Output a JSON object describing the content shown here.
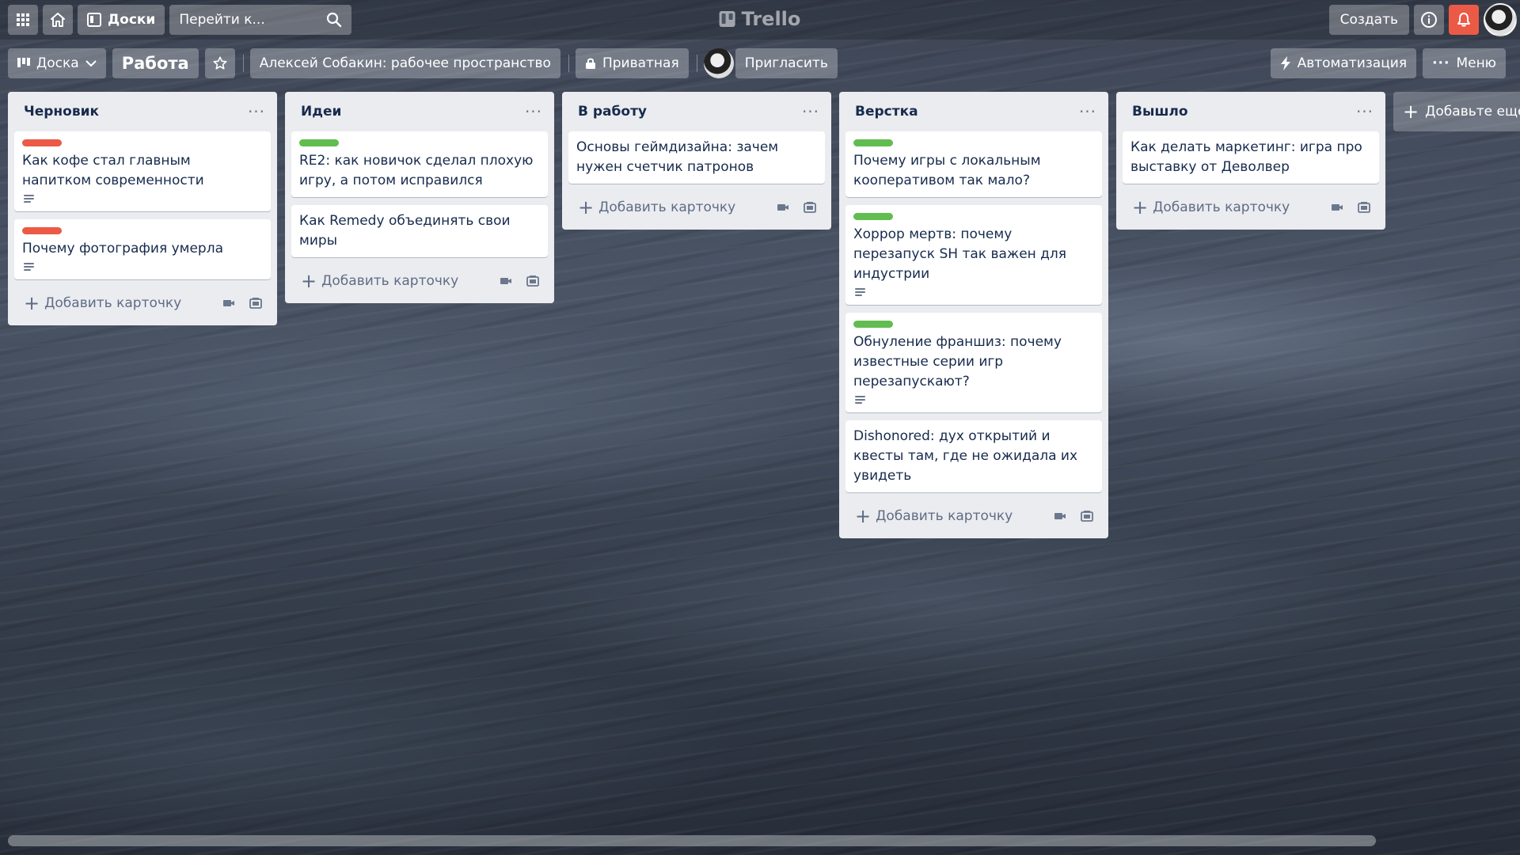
{
  "header": {
    "apps_icon": "grid-icon",
    "home_icon": "home-icon",
    "boards_label": "Доски",
    "search_placeholder": "Перейти к...",
    "logo_text": "Trello",
    "create_label": "Создать"
  },
  "board": {
    "view_label": "Доска",
    "title": "Работа",
    "workspace": "Алексей Собакин: рабочее пространство",
    "visibility": "Приватная",
    "invite_label": "Пригласить",
    "automation_label": "Автоматизация",
    "menu_label": "Меню",
    "add_list_label": "Добавьте еще",
    "add_card_label": "Добавить карточку"
  },
  "colors": {
    "label_red": "#eb5a46",
    "label_green": "#61bd4f",
    "bell_bg": "#eb5a46"
  },
  "lists": [
    {
      "title": "Черновик",
      "cards": [
        {
          "label": "red",
          "text": "Как кофе стал главным напитком современности",
          "has_description": true
        },
        {
          "label": "red",
          "text": "Почему фотография умерла",
          "has_description": true
        }
      ]
    },
    {
      "title": "Идеи",
      "cards": [
        {
          "label": "green",
          "text": "RE2: как новичок сделал плохую игру, а потом исправился",
          "has_description": false
        },
        {
          "label": null,
          "text": "Как Remedy объединять свои миры",
          "has_description": false
        }
      ]
    },
    {
      "title": "В работу",
      "cards": [
        {
          "label": null,
          "text": "Основы геймдизайна: зачем нужен счетчик патронов",
          "has_description": false
        }
      ]
    },
    {
      "title": "Верстка",
      "cards": [
        {
          "label": "green",
          "text": "Почему игры с локальным кооперативом так мало?",
          "has_description": false
        },
        {
          "label": "green",
          "text": "Хоррор мертв: почему перезапуск SH так важен для индустрии",
          "has_description": true
        },
        {
          "label": "green",
          "text": "Обнуление франшиз: почему известные серии игр перезапускают?",
          "has_description": true
        },
        {
          "label": null,
          "text": "Dishonored: дух открытий и квесты там, где не ожидала их увидеть",
          "has_description": false
        }
      ]
    },
    {
      "title": "Вышло",
      "cards": [
        {
          "label": null,
          "text": "Как делать маркетинг: игра про выставку от Деволвер",
          "has_description": false
        }
      ]
    }
  ]
}
